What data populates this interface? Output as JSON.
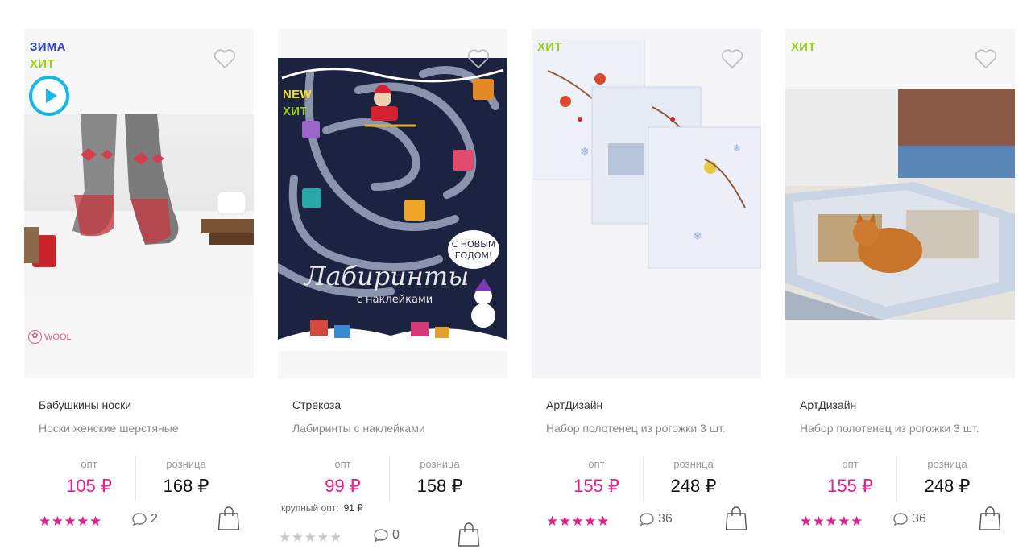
{
  "products": [
    {
      "badges": [
        "ЗИМА",
        "ХИТ"
      ],
      "has_video": true,
      "logo": "WOOL",
      "brand": "Бабушкины носки",
      "name": "Носки женские шерстяные",
      "opt_label": "опт",
      "opt_price": "105 ₽",
      "retail_label": "розница",
      "retail_price": "168 ₽",
      "rating": 5,
      "stars": "★★★★★",
      "comments": "2"
    },
    {
      "badges": [
        "NEW",
        "ХИТ"
      ],
      "has_video": false,
      "cover_title": "Лабиринты",
      "cover_subtitle": "с наклейками",
      "cover_bubble": "С НОВЫМ ГОДОМ!",
      "brand": "Стрекоза",
      "name": "Лабиринты с наклейками",
      "opt_label": "опт",
      "opt_price": "99 ₽",
      "retail_label": "розница",
      "retail_price": "158 ₽",
      "bulk_label": "крупный опт:",
      "bulk_price": "91 ₽",
      "rating": 0,
      "stars": "★★★★★",
      "comments": "0"
    },
    {
      "badges": [
        "ХИТ"
      ],
      "has_video": false,
      "brand": "АртДизайн",
      "name": "Набор полотенец из рогожки 3 шт.",
      "opt_label": "опт",
      "opt_price": "155 ₽",
      "retail_label": "розница",
      "retail_price": "248 ₽",
      "rating": 5,
      "stars": "★★★★★",
      "comments": "36"
    },
    {
      "badges": [
        "ХИТ"
      ],
      "has_video": false,
      "brand": "АртДизайн",
      "name": "Набор полотенец из рогожки 3 шт.",
      "opt_label": "опт",
      "opt_price": "155 ₽",
      "retail_label": "розница",
      "retail_price": "248 ₽",
      "rating": 5,
      "stars": "★★★★★",
      "comments": "36"
    }
  ],
  "colors": {
    "accent_pink": "#ec1c8a",
    "badge_blue": "#2b40c8",
    "badge_green": "#9acd1c",
    "badge_yellow": "#f0e02a",
    "video_blue": "#14b8e8"
  },
  "icons": {
    "favorite": "heart-outline-icon",
    "comments": "speech-bubble-icon",
    "cart": "shopping-bag-icon",
    "video": "play-icon"
  }
}
